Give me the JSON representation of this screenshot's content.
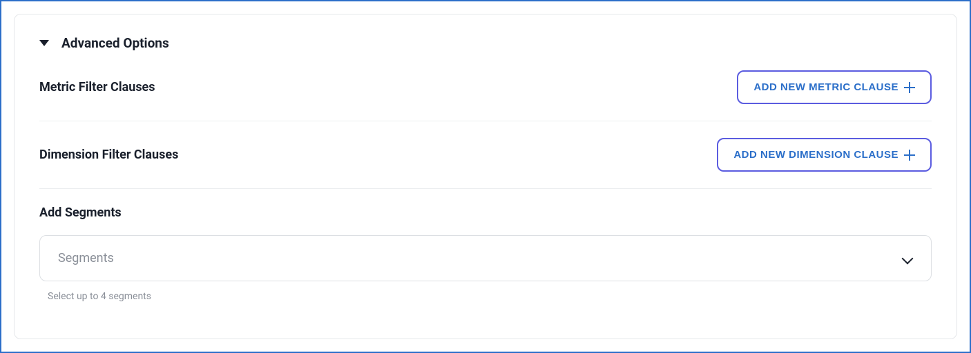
{
  "header": {
    "title": "Advanced Options"
  },
  "metric_filter": {
    "label": "Metric Filter Clauses",
    "button_label": "ADD NEW METRIC CLAUSE"
  },
  "dimension_filter": {
    "label": "Dimension Filter Clauses",
    "button_label": "ADD NEW DIMENSION CLAUSE"
  },
  "segments": {
    "label": "Add Segments",
    "placeholder": "Segments",
    "helper": "Select up to 4 segments"
  }
}
